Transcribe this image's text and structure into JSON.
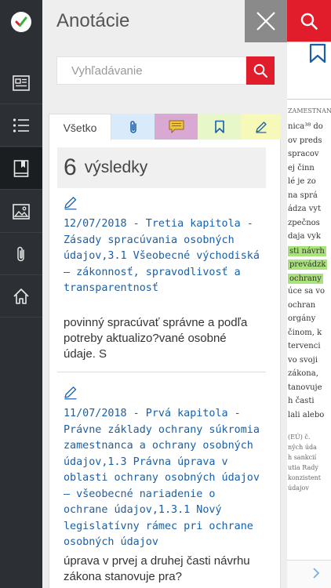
{
  "rail": {
    "items": [
      {
        "name": "rail-item-documents",
        "icon": "newspaper-icon"
      },
      {
        "name": "rail-item-contents",
        "icon": "list-icon"
      },
      {
        "name": "rail-item-annotations",
        "icon": "book-bookmark-icon",
        "active": true
      },
      {
        "name": "rail-item-images",
        "icon": "image-icon"
      },
      {
        "name": "rail-item-attachments",
        "icon": "paperclip-icon"
      },
      {
        "name": "rail-item-home",
        "icon": "home-icon"
      }
    ]
  },
  "panel": {
    "title": "Anotácie",
    "search": {
      "placeholder": "Vyhľadávanie"
    },
    "tabs": {
      "all_label": "Všetko",
      "icons": [
        "paperclip-icon",
        "comment-icon",
        "bookmark-icon",
        "pencil-icon"
      ]
    },
    "result_count": "6",
    "result_label": "výsledky",
    "items": [
      {
        "icon": "pencil-icon",
        "title": "12/07/2018 - Tretia kapitola - Zásady spracúvania osobných údajov,3.1 Všeobecné východiská — zákonnosť, spravodlivosť a transparentnosť",
        "note": "povinný spracúvať správne a podľa potreby aktualizo?vané osobné údaje. S"
      },
      {
        "icon": "pencil-icon",
        "title": "11/07/2018 - Prvá kapitola - Právne základy ochrany súkromia zamestnanca a ochrany osobných údajov,1.3 Právna úprava v oblasti ochrany osobných údajov — všeobecné nariadenie o ochrane údajov,1.3.1 Nový legislatívny rámec pri ochrane osobných údajov",
        "note": "úprava v prvej a  druhej časti návrhu zákona stanovuje pra?"
      }
    ]
  },
  "document": {
    "lines": [
      {
        "text": "ZAMESTNANCA",
        "cls": "small"
      },
      {
        "text": "nica³⁸ do"
      },
      {
        "text": "ov preds"
      },
      {
        "text": "spracov"
      },
      {
        "text": "ej činn"
      },
      {
        "text": "lé je zo"
      },
      {
        "text": "na sprá"
      },
      {
        "text": "ádza vyt"
      },
      {
        "text": "zpečnos"
      },
      {
        "text": "daja vyk"
      },
      {
        "text": "sti návrh",
        "cls": "hl-green"
      },
      {
        "text": "prevádzk",
        "cls": "hl-green"
      },
      {
        "text": "ochrany",
        "cls": "hl-green"
      },
      {
        "text": "úce sa vo"
      },
      {
        "text": "ochran"
      },
      {
        "text": "orgány"
      },
      {
        "text": "činom, k"
      },
      {
        "text": "tervenci"
      },
      {
        "text": "vo svoji"
      },
      {
        "text": "zákona,"
      },
      {
        "text": "tanovuje"
      },
      {
        "text": "h časti"
      },
      {
        "text": "lali alebo"
      },
      {
        "text": "(EÚ) č.",
        "cls": "small"
      },
      {
        "text": "ných úda",
        "cls": "small"
      },
      {
        "text": "h sankcií",
        "cls": "small"
      },
      {
        "text": "utia Rady",
        "cls": "small"
      },
      {
        "text": "konzistent",
        "cls": "small"
      },
      {
        "text": "údajov",
        "cls": "small"
      }
    ]
  },
  "colors": {
    "accent": "#e21d2b",
    "rail_bg": "#2c3035",
    "link": "#1a5fa8",
    "tab_attachment": "#d9eafb",
    "tab_comment": "#d9a9d4",
    "tab_bookmark": "#e8f7c8",
    "tab_highlight": "#f6f9b8"
  }
}
